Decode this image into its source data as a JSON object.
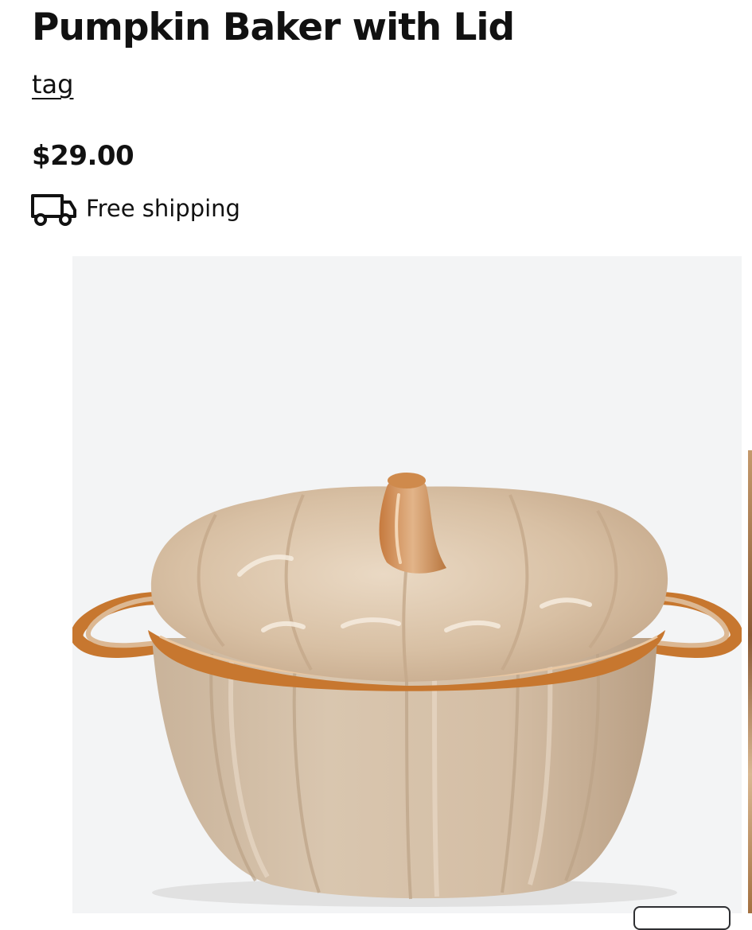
{
  "product": {
    "title": "Pumpkin Baker with Lid",
    "brand_link": "tag",
    "price": "$29.00",
    "shipping_text": "Free shipping",
    "shipping_icon": "truck-icon"
  },
  "gallery": {
    "image_subject": "pumpkin-baker-with-lid-photo"
  },
  "colors": {
    "text": "#111111",
    "image_background": "#f3f4f5",
    "glaze": "#d9c3a8",
    "rim": "#c7772f"
  }
}
